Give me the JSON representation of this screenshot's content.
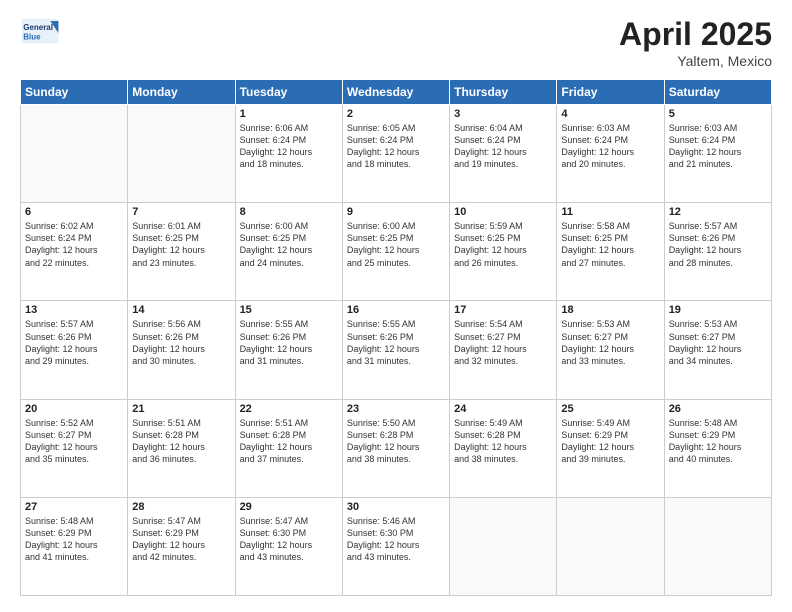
{
  "header": {
    "logo_text_general": "General",
    "logo_text_blue": "Blue",
    "title": "April 2025",
    "location": "Yaltem, Mexico"
  },
  "calendar": {
    "days_of_week": [
      "Sunday",
      "Monday",
      "Tuesday",
      "Wednesday",
      "Thursday",
      "Friday",
      "Saturday"
    ],
    "weeks": [
      [
        {
          "day": "",
          "info": ""
        },
        {
          "day": "",
          "info": ""
        },
        {
          "day": "1",
          "info": "Sunrise: 6:06 AM\nSunset: 6:24 PM\nDaylight: 12 hours\nand 18 minutes."
        },
        {
          "day": "2",
          "info": "Sunrise: 6:05 AM\nSunset: 6:24 PM\nDaylight: 12 hours\nand 18 minutes."
        },
        {
          "day": "3",
          "info": "Sunrise: 6:04 AM\nSunset: 6:24 PM\nDaylight: 12 hours\nand 19 minutes."
        },
        {
          "day": "4",
          "info": "Sunrise: 6:03 AM\nSunset: 6:24 PM\nDaylight: 12 hours\nand 20 minutes."
        },
        {
          "day": "5",
          "info": "Sunrise: 6:03 AM\nSunset: 6:24 PM\nDaylight: 12 hours\nand 21 minutes."
        }
      ],
      [
        {
          "day": "6",
          "info": "Sunrise: 6:02 AM\nSunset: 6:24 PM\nDaylight: 12 hours\nand 22 minutes."
        },
        {
          "day": "7",
          "info": "Sunrise: 6:01 AM\nSunset: 6:25 PM\nDaylight: 12 hours\nand 23 minutes."
        },
        {
          "day": "8",
          "info": "Sunrise: 6:00 AM\nSunset: 6:25 PM\nDaylight: 12 hours\nand 24 minutes."
        },
        {
          "day": "9",
          "info": "Sunrise: 6:00 AM\nSunset: 6:25 PM\nDaylight: 12 hours\nand 25 minutes."
        },
        {
          "day": "10",
          "info": "Sunrise: 5:59 AM\nSunset: 6:25 PM\nDaylight: 12 hours\nand 26 minutes."
        },
        {
          "day": "11",
          "info": "Sunrise: 5:58 AM\nSunset: 6:25 PM\nDaylight: 12 hours\nand 27 minutes."
        },
        {
          "day": "12",
          "info": "Sunrise: 5:57 AM\nSunset: 6:26 PM\nDaylight: 12 hours\nand 28 minutes."
        }
      ],
      [
        {
          "day": "13",
          "info": "Sunrise: 5:57 AM\nSunset: 6:26 PM\nDaylight: 12 hours\nand 29 minutes."
        },
        {
          "day": "14",
          "info": "Sunrise: 5:56 AM\nSunset: 6:26 PM\nDaylight: 12 hours\nand 30 minutes."
        },
        {
          "day": "15",
          "info": "Sunrise: 5:55 AM\nSunset: 6:26 PM\nDaylight: 12 hours\nand 31 minutes."
        },
        {
          "day": "16",
          "info": "Sunrise: 5:55 AM\nSunset: 6:26 PM\nDaylight: 12 hours\nand 31 minutes."
        },
        {
          "day": "17",
          "info": "Sunrise: 5:54 AM\nSunset: 6:27 PM\nDaylight: 12 hours\nand 32 minutes."
        },
        {
          "day": "18",
          "info": "Sunrise: 5:53 AM\nSunset: 6:27 PM\nDaylight: 12 hours\nand 33 minutes."
        },
        {
          "day": "19",
          "info": "Sunrise: 5:53 AM\nSunset: 6:27 PM\nDaylight: 12 hours\nand 34 minutes."
        }
      ],
      [
        {
          "day": "20",
          "info": "Sunrise: 5:52 AM\nSunset: 6:27 PM\nDaylight: 12 hours\nand 35 minutes."
        },
        {
          "day": "21",
          "info": "Sunrise: 5:51 AM\nSunset: 6:28 PM\nDaylight: 12 hours\nand 36 minutes."
        },
        {
          "day": "22",
          "info": "Sunrise: 5:51 AM\nSunset: 6:28 PM\nDaylight: 12 hours\nand 37 minutes."
        },
        {
          "day": "23",
          "info": "Sunrise: 5:50 AM\nSunset: 6:28 PM\nDaylight: 12 hours\nand 38 minutes."
        },
        {
          "day": "24",
          "info": "Sunrise: 5:49 AM\nSunset: 6:28 PM\nDaylight: 12 hours\nand 38 minutes."
        },
        {
          "day": "25",
          "info": "Sunrise: 5:49 AM\nSunset: 6:29 PM\nDaylight: 12 hours\nand 39 minutes."
        },
        {
          "day": "26",
          "info": "Sunrise: 5:48 AM\nSunset: 6:29 PM\nDaylight: 12 hours\nand 40 minutes."
        }
      ],
      [
        {
          "day": "27",
          "info": "Sunrise: 5:48 AM\nSunset: 6:29 PM\nDaylight: 12 hours\nand 41 minutes."
        },
        {
          "day": "28",
          "info": "Sunrise: 5:47 AM\nSunset: 6:29 PM\nDaylight: 12 hours\nand 42 minutes."
        },
        {
          "day": "29",
          "info": "Sunrise: 5:47 AM\nSunset: 6:30 PM\nDaylight: 12 hours\nand 43 minutes."
        },
        {
          "day": "30",
          "info": "Sunrise: 5:46 AM\nSunset: 6:30 PM\nDaylight: 12 hours\nand 43 minutes."
        },
        {
          "day": "",
          "info": ""
        },
        {
          "day": "",
          "info": ""
        },
        {
          "day": "",
          "info": ""
        }
      ]
    ]
  }
}
